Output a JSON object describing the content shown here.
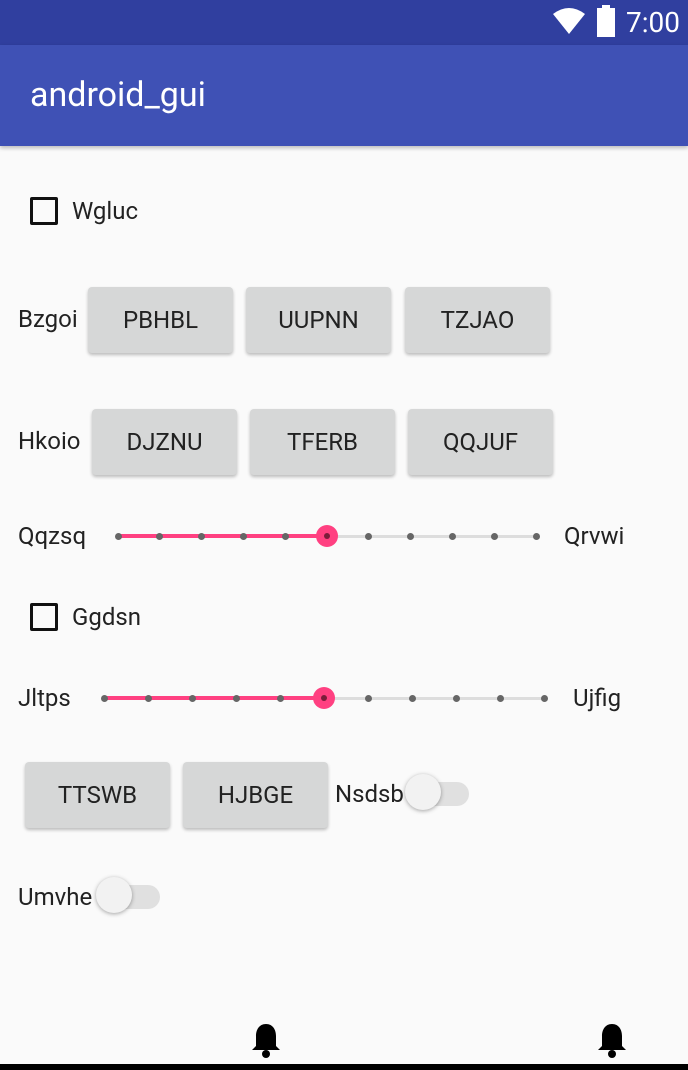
{
  "status_bar": {
    "time": "7:00",
    "icons": [
      "wifi-icon",
      "battery-icon"
    ]
  },
  "app_bar": {
    "title": "android_gui"
  },
  "checkboxes": [
    {
      "label": "Wgluc",
      "checked": false
    },
    {
      "label": "Ggdsn",
      "checked": false
    }
  ],
  "rows": [
    {
      "label": "Bzgoi",
      "buttons": [
        "PBHBL",
        "UUPNN",
        "TZJAO"
      ]
    },
    {
      "label": "Hkoio",
      "buttons": [
        "DJZNU",
        "TFERB",
        "QQJUF"
      ]
    }
  ],
  "seekbars": [
    {
      "left_label": "Qqzsq",
      "right_label": "Qrvwi",
      "value": 5,
      "max": 10
    },
    {
      "left_label": "Jltps",
      "right_label": "Ujfig",
      "value": 5,
      "max": 10
    }
  ],
  "bottom_buttons": [
    "TTSWB",
    "HJBGE"
  ],
  "switches": [
    {
      "label": "Nsdsb",
      "on": false
    },
    {
      "label": "Umvhe",
      "on": false
    }
  ],
  "colors": {
    "primary": "#3f51b5",
    "primary_dark": "#303f9f",
    "accent": "#ff4081",
    "button": "#d6d7d7"
  },
  "nav_icons": [
    "bell-icon",
    "bell-icon"
  ]
}
